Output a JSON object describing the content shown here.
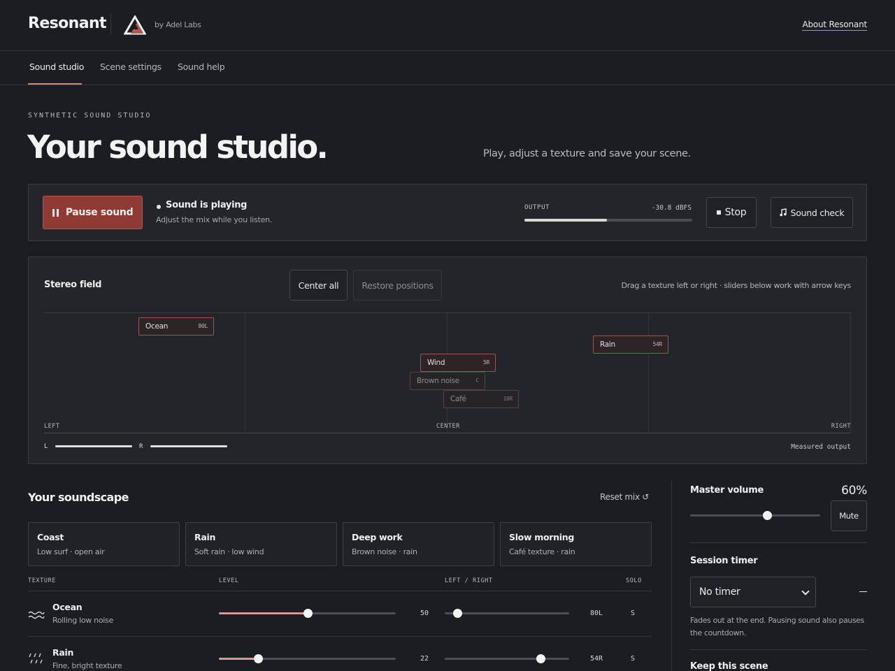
{
  "header": {
    "brand": "Resonant",
    "byline": "by Adel Labs",
    "about_link": "About Resonant",
    "logo_icon": "triangle-logo-icon"
  },
  "tabs": [
    {
      "label": "Sound studio",
      "active": true
    },
    {
      "label": "Scene settings",
      "active": false
    },
    {
      "label": "Sound help",
      "active": false
    }
  ],
  "hero": {
    "eyebrow": "SYNTHETIC SOUND STUDIO",
    "title": "Your sound studio.",
    "subtitle": "Play, adjust a texture and save your scene."
  },
  "player": {
    "pause_label": "Pause sound",
    "status_title": "Sound is playing",
    "status_sub": "Adjust the mix while you listen.",
    "output_label": "OUTPUT",
    "output_value": "-30.8 dBFS",
    "output_level": 0.49,
    "stop_label": "Stop",
    "sound_check_label": "Sound check"
  },
  "stereo": {
    "title": "Stereo field",
    "center_all": "Center all",
    "restore_positions": "Restore positions",
    "hint": "Drag a texture left or right · sliders below work with arrow keys",
    "left_label": "LEFT",
    "center_label": "CENTER",
    "right_label": "RIGHT",
    "chips": [
      {
        "name": "Ocean",
        "pan": "80L"
      },
      {
        "name": "Rain",
        "pan": "54R"
      },
      {
        "name": "Wind",
        "pan": "5R"
      },
      {
        "name": "Brown noise",
        "pan": "C"
      },
      {
        "name": "Café",
        "pan": "10R"
      }
    ],
    "meter_l": "L",
    "meter_r": "R",
    "measured": "Measured output"
  },
  "soundscape": {
    "title": "Your soundscape",
    "reset": "Reset mix ↺",
    "presets": [
      {
        "name": "Coast",
        "desc": "Low surf · open air"
      },
      {
        "name": "Rain",
        "desc": "Soft rain · low wind"
      },
      {
        "name": "Deep work",
        "desc": "Brown noise · rain"
      },
      {
        "name": "Slow morning",
        "desc": "Café texture · rain"
      }
    ],
    "columns": {
      "texture": "TEXTURE",
      "level": "LEVEL",
      "pan": "LEFT / RIGHT",
      "solo": "SOLO"
    },
    "rows": [
      {
        "name": "Ocean",
        "desc": "Rolling low noise",
        "level": 50,
        "level_text": "50",
        "pan_text": "80L",
        "pan_value": -80,
        "solo": "S",
        "icon": "waves-icon"
      },
      {
        "name": "Rain",
        "desc": "Fine, bright texture",
        "level": 22,
        "level_text": "22",
        "pan_text": "54R",
        "pan_value": 54,
        "solo": "S",
        "icon": "rain-icon"
      }
    ]
  },
  "side": {
    "master_label": "Master volume",
    "master_pct": "60%",
    "master_value": 0.59,
    "mute": "Mute",
    "timer_label": "Session timer",
    "timer_value": "No timer",
    "timer_dash": "—",
    "fade_note": "Fades out at the end. Pausing sound also pauses the countdown.",
    "keep_label": "Keep this scene"
  },
  "colors": {
    "accent": "#c98a7e",
    "primary_button": "#8f3a33",
    "background": "#1b1d22"
  }
}
